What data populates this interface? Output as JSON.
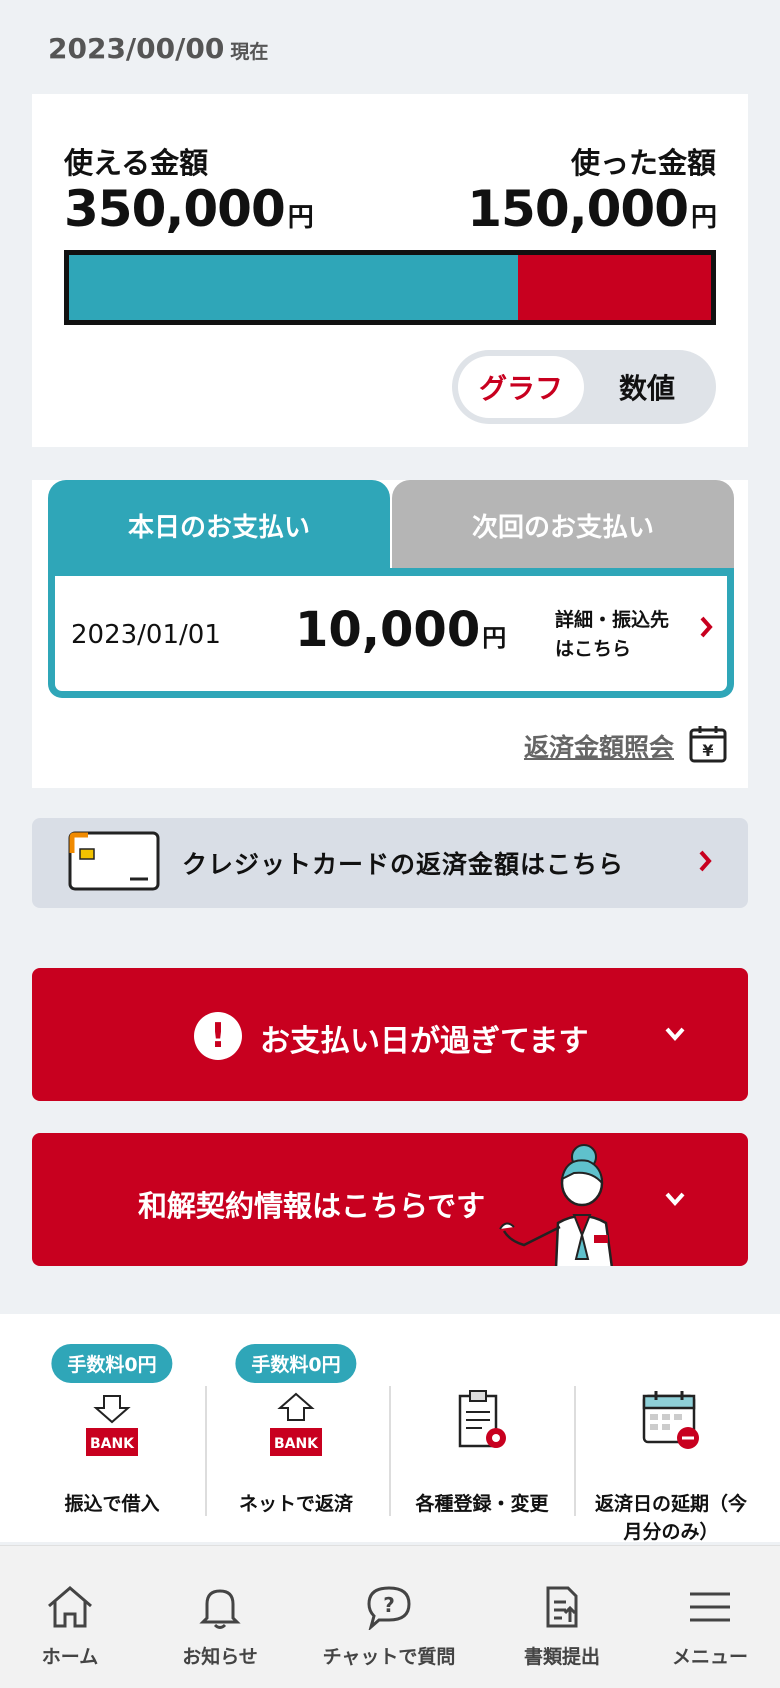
{
  "header": {
    "date": "2023/00/00",
    "date_suffix": "現在"
  },
  "balance": {
    "available_label": "使える金額",
    "available_amount": "350,000",
    "used_label": "使った金額",
    "used_amount": "150,000",
    "yen": "円",
    "used_fraction": 0.3,
    "bar_colors": {
      "available": "#2fa6b8",
      "used": "#c8001f"
    },
    "toggle": {
      "graph": "グラフ",
      "number": "数値",
      "selected": "graph"
    }
  },
  "payment": {
    "tab_today": "本日のお支払い",
    "tab_next": "次回のお支払い",
    "date": "2023/01/01",
    "amount": "10,000",
    "yen": "円",
    "detail_line1": "詳細・振込先",
    "detail_line2": "はこちら",
    "lookup": "返済金額照会"
  },
  "credit_card": {
    "label": "クレジットカードの返済金額はこちら"
  },
  "alerts": {
    "overdue": "お支払い日が過ぎてます",
    "settlement": "和解契約情報はこちらです"
  },
  "quick_actions": [
    {
      "fee": "手数料0円",
      "label": "振込で借入",
      "icon": "bank-transfer-in-icon"
    },
    {
      "fee": "手数料0円",
      "label": "ネットで返済",
      "icon": "bank-transfer-out-icon"
    },
    {
      "label": "各種登録・変更",
      "icon": "clipboard-gear-icon"
    },
    {
      "label_line1": "返済日の延期（今",
      "label_line2": "月分のみ）",
      "icon": "calendar-minus-icon"
    }
  ],
  "nav": [
    {
      "label": "ホーム",
      "icon": "home-icon"
    },
    {
      "label": "お知らせ",
      "icon": "bell-icon"
    },
    {
      "label": "チャットで質問",
      "icon": "chat-question-icon"
    },
    {
      "label": "書類提出",
      "icon": "document-upload-icon"
    },
    {
      "label": "メニュー",
      "icon": "hamburger-menu-icon"
    }
  ],
  "colors": {
    "brand_red": "#c8001f",
    "teal": "#2fa6b8",
    "background": "#eef1f4"
  }
}
